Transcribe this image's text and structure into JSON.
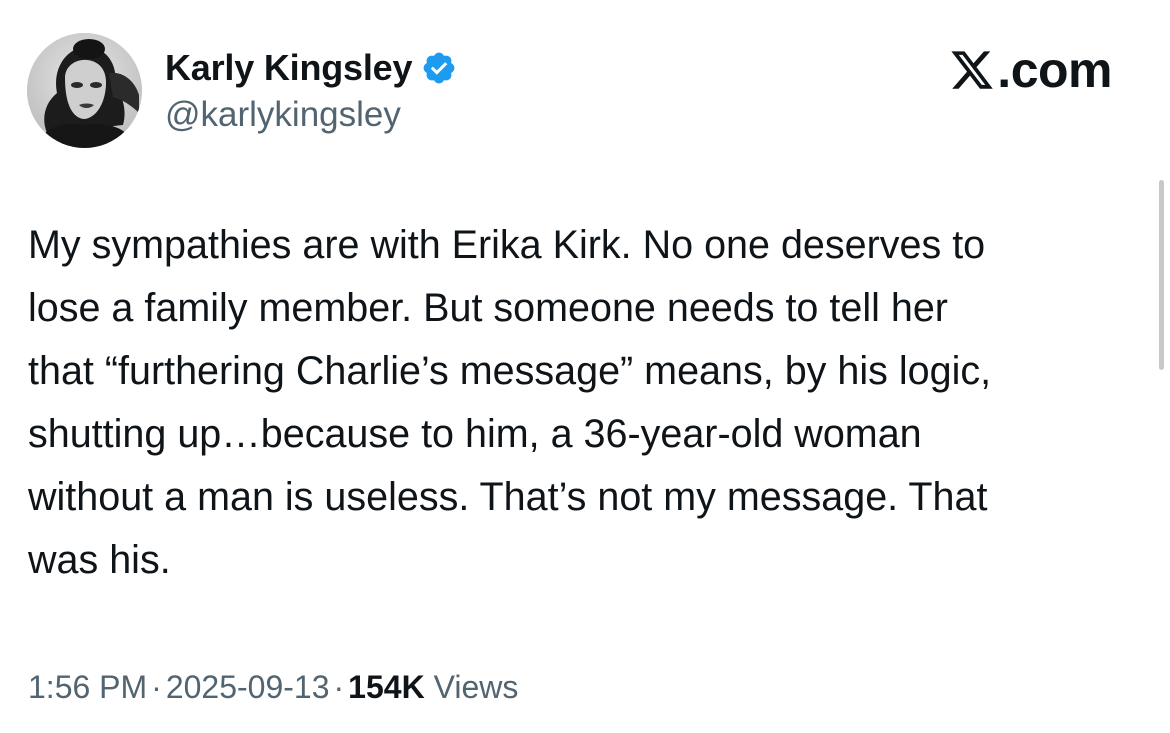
{
  "author": {
    "display_name": "Karly Kingsley",
    "handle": "@karlykingsley",
    "verified_icon": "verified-badge-icon",
    "verified_color": "#1d9bf0"
  },
  "brand": {
    "icon": "x-logo-icon",
    "text": ".com"
  },
  "tweet": {
    "lines": [
      "My sympathies are with Erika Kirk. No one deserves to",
      "lose a family member. But someone needs to tell her",
      "that “furthering Charlie’s message” means, by his logic,",
      "shutting up…because to him, a 36-year-old woman",
      "without a man is useless. That’s not my message. That",
      "was his."
    ]
  },
  "meta": {
    "time": "1:56 PM",
    "separator": "·",
    "date": "2025-09-13",
    "views_count": "154K",
    "views_label": "Views"
  },
  "colors": {
    "text_primary": "#0f1419",
    "text_secondary": "#536471"
  }
}
